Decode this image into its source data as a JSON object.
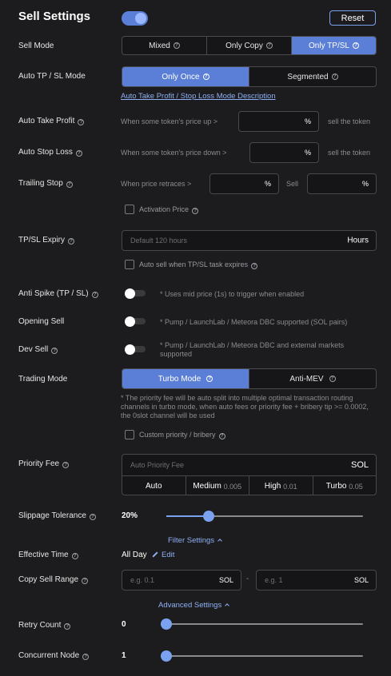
{
  "header": {
    "title": "Sell Settings",
    "reset_label": "Reset",
    "master_toggle": true
  },
  "sell_mode": {
    "label": "Sell Mode",
    "options": [
      "Mixed",
      "Only Copy",
      "Only TP/SL"
    ],
    "selected": "Only TP/SL"
  },
  "tp_sl_mode": {
    "label": "Auto TP / SL Mode",
    "options": [
      "Only Once",
      "Segmented"
    ],
    "selected": "Only Once",
    "description_link": "Auto Take Profit / Stop Loss Mode Description"
  },
  "take_profit": {
    "label": "Auto Take Profit",
    "prefix": "When some token's price up >",
    "unit": "%",
    "suffix": "sell the token",
    "value": ""
  },
  "stop_loss": {
    "label": "Auto Stop Loss",
    "prefix": "When some token's price down >",
    "unit": "%",
    "suffix": "sell the token",
    "value": ""
  },
  "trailing_stop": {
    "label": "Trailing Stop",
    "prefix": "When price retraces >",
    "unit": "%",
    "sell_label": "Sell",
    "sell_unit": "%",
    "activation_label": "Activation Price"
  },
  "expiry": {
    "label": "TP/SL Expiry",
    "placeholder": "Default 120 hours",
    "unit": "Hours",
    "auto_sell_label": "Auto sell when TP/SL task expires"
  },
  "anti_spike": {
    "label": "Anti Spike (TP / SL)",
    "hint": "* Uses mid price (1s) to trigger when enabled",
    "enabled": false
  },
  "opening_sell": {
    "label": "Opening Sell",
    "hint": "* Pump / LaunchLab / Meteora DBC supported (SOL pairs)",
    "enabled": false
  },
  "dev_sell": {
    "label": "Dev Sell",
    "hint": "* Pump / LaunchLab / Meteora DBC and external markets supported",
    "enabled": false
  },
  "trading_mode": {
    "label": "Trading Mode",
    "options": [
      "Turbo Mode",
      "Anti-MEV"
    ],
    "selected": "Turbo Mode",
    "hint": "* The priority fee will be auto split into multiple optimal transaction routing channels in turbo mode, when auto fees or priority fee + bribery tip >= 0.0002, the 0slot channel will be used",
    "custom_label": "Custom priority / bribery"
  },
  "priority_fee": {
    "label": "Priority Fee",
    "placeholder": "Auto Priority Fee",
    "unit": "SOL",
    "presets": [
      {
        "name": "Auto",
        "value": ""
      },
      {
        "name": "Medium",
        "value": "0.005"
      },
      {
        "name": "High",
        "value": "0.01"
      },
      {
        "name": "Turbo",
        "value": "0.05"
      }
    ]
  },
  "slippage": {
    "label": "Slippage Tolerance",
    "value_text": "20%",
    "fraction": 0.2
  },
  "filter": {
    "toggle_label": "Filter Settings",
    "effective_time": {
      "label": "Effective Time",
      "value": "All Day",
      "edit_label": "Edit"
    },
    "copy_sell_range": {
      "label": "Copy Sell Range",
      "min_placeholder": "e.g. 0.1",
      "max_placeholder": "e.g. 1",
      "unit": "SOL",
      "separator": "-"
    }
  },
  "advanced": {
    "toggle_label": "Advanced Settings",
    "retry_count": {
      "label": "Retry Count",
      "value": "0",
      "fraction": 0
    },
    "concurrent_node": {
      "label": "Concurrent Node",
      "value": "1",
      "fraction": 0
    }
  },
  "colors": {
    "accent": "#5b7fd6",
    "slider": "#7aa2f0",
    "link": "#8fb0f5",
    "background": "#1c1c1e"
  }
}
